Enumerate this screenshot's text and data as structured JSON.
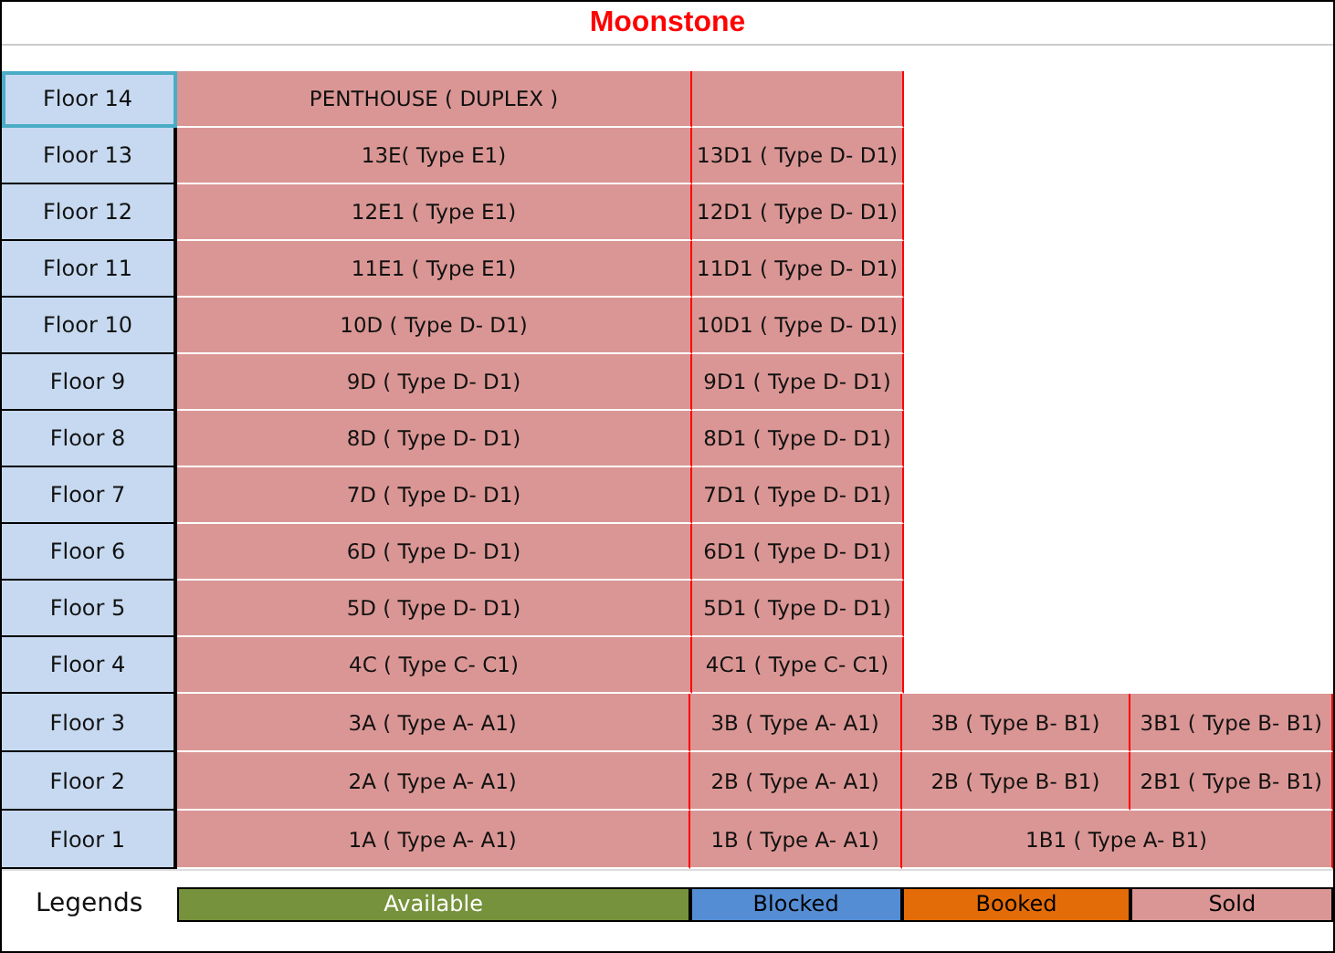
{
  "title": "Moonstone",
  "floors": [
    {
      "label": "Floor 14",
      "selected": true,
      "units": [
        {
          "label": "PENTHOUSE ( DUPLEX )",
          "color": "#da9694",
          "merged": false
        },
        {
          "color": "#da9694",
          "merged": false
        }
      ]
    },
    {
      "label": "Floor 13",
      "selected": false,
      "units": [
        {
          "label": "13E( Type E1)",
          "color": "#da9694",
          "merged": false
        },
        {
          "label": "13D1 ( Type D- D1)",
          "color": "#da9694",
          "merged": false
        }
      ]
    },
    {
      "label": "Floor 12",
      "selected": false,
      "units": [
        {
          "label": "12E1 ( Type E1)",
          "color": "#da9694",
          "merged": false
        },
        {
          "label": "12D1 ( Type D- D1)",
          "color": "#da9694",
          "merged": false
        }
      ]
    },
    {
      "label": "Floor 11",
      "selected": false,
      "units": [
        {
          "label": "11E1 ( Type E1)",
          "color": "#da9694",
          "merged": false
        },
        {
          "label": "11D1 ( Type D- D1)",
          "color": "#da9694",
          "merged": false
        }
      ]
    },
    {
      "label": "Floor 10",
      "selected": false,
      "units": [
        {
          "label": "10D ( Type D- D1)",
          "color": "#da9694",
          "merged": false
        },
        {
          "label": "10D1 ( Type D- D1)",
          "color": "#da9694",
          "merged": false
        }
      ]
    },
    {
      "label": "Floor 9",
      "selected": false,
      "units": [
        {
          "label": "9D ( Type D- D1)",
          "color": "#da9694",
          "merged": false
        },
        {
          "label": "9D1 ( Type D- D1)",
          "color": "#da9694",
          "merged": false
        }
      ]
    },
    {
      "label": "Floor 8",
      "selected": false,
      "units": [
        {
          "label": "8D ( Type D- D1)",
          "color": "#da9694",
          "merged": false
        },
        {
          "label": "8D1 ( Type D- D1)",
          "color": "#da9694",
          "merged": false
        }
      ]
    },
    {
      "label": "Floor 7",
      "selected": false,
      "units": [
        {
          "label": "7D ( Type D- D1)",
          "color": "#da9694",
          "merged": false
        },
        {
          "label": "7D1 ( Type D- D1)",
          "color": "#da9694",
          "merged": false
        }
      ]
    },
    {
      "label": "Floor 6",
      "selected": false,
      "units": [
        {
          "label": "6D ( Type D- D1)",
          "color": "#da9694",
          "merged": false
        },
        {
          "label": "6D1 ( Type D- D1)",
          "color": "#da9694",
          "merged": false
        }
      ]
    },
    {
      "label": "Floor 5",
      "selected": false,
      "units": [
        {
          "label": "5D ( Type D- D1)",
          "color": "#da9694",
          "merged": false
        },
        {
          "label": "5D1 ( Type D- D1)",
          "color": "#da9694",
          "merged": false
        }
      ]
    },
    {
      "label": "Floor 4",
      "selected": false,
      "units": [
        {
          "label": "4C ( Type C- C1)",
          "color": "#da9694",
          "merged": false
        },
        {
          "label": "4C1 ( Type C- C1)",
          "color": "#da9694",
          "merged": false
        }
      ]
    },
    {
      "label": "Floor 3",
      "selected": false,
      "units": [
        {
          "label": "3A ( Type A- A1)",
          "color": "#da9694",
          "merged": false
        },
        {
          "label": "3B ( Type A- A1)",
          "color": "#da9694",
          "merged": false
        },
        {
          "label": "3B ( Type B- B1)",
          "color": "#da9694",
          "merged": false
        },
        {
          "label": "3B1 ( Type B- B1)",
          "color": "#da9694",
          "merged": false
        }
      ]
    },
    {
      "label": "Floor 2",
      "selected": false,
      "units": [
        {
          "label": "2A ( Type A- A1)",
          "color": "#da9694",
          "merged": false
        },
        {
          "label": "2B ( Type A- A1)",
          "color": "#da9694",
          "merged": false
        },
        {
          "label": "2B ( Type B- B1)",
          "color": "#da9694",
          "merged": false
        },
        {
          "label": "2B1 ( Type B- B1)",
          "color": "#da9694",
          "merged": false
        }
      ]
    },
    {
      "label": "Floor 1",
      "selected": false,
      "units": [
        {
          "label": "1A ( Type A- A1)",
          "color": "#da9694",
          "merged": false
        },
        {
          "label": "1B ( Type A- A1)",
          "color": "#da9694",
          "merged": false
        },
        {
          "label": "1B1 ( Type A- B1)",
          "color": "#da9694",
          "merged": true
        }
      ]
    }
  ],
  "legend": {
    "label": "Legends",
    "items": [
      {
        "label": "Available",
        "kind": "available",
        "color": "#76923c"
      },
      {
        "label": "Blocked",
        "kind": "blocked",
        "color": "#548dd4"
      },
      {
        "label": "Booked",
        "kind": "booked",
        "color": "#e36c09"
      },
      {
        "label": "Sold",
        "kind": "sold",
        "color": "#da9694"
      }
    ]
  }
}
